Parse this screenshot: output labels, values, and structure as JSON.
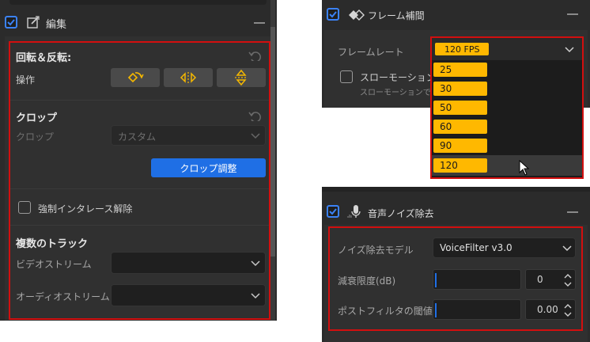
{
  "edit_panel": {
    "title": "編集",
    "rotate_section": {
      "title": "回転＆反転:",
      "operation_label": "操作"
    },
    "crop_section": {
      "title": "クロップ",
      "crop_label": "クロップ",
      "crop_value": "カスタム",
      "adjust_button": "クロップ調整"
    },
    "deinterlace_label": "強制インタレース解除",
    "tracks_section": {
      "title": "複数のトラック",
      "video_stream_label": "ビデオストリーム",
      "audio_stream_label": "オーディオストリーム"
    }
  },
  "frame_panel": {
    "title": "フレーム補間",
    "frame_rate_label": "フレームレート",
    "frame_rate_value": "120 FPS",
    "slow_motion_label": "スローモーション",
    "slow_motion_sub": "スローモーションで",
    "options": [
      "25",
      "30",
      "50",
      "60",
      "90",
      "120"
    ]
  },
  "noise_panel": {
    "title": "音声ノイズ除去",
    "model_label": "ノイズ除去モデル",
    "model_value": "VoiceFilter v3.0",
    "attenuation_label": "減衰限度(dB)",
    "attenuation_value": "0",
    "postfilter_label": "ポストフィルタの閾値",
    "postfilter_value": "0.00"
  },
  "colors": {
    "highlight_red": "#d20f0f",
    "accent_blue": "#1f6fe5",
    "option_yellow": "#ffb800",
    "panel_bg": "#2b2b2b"
  }
}
